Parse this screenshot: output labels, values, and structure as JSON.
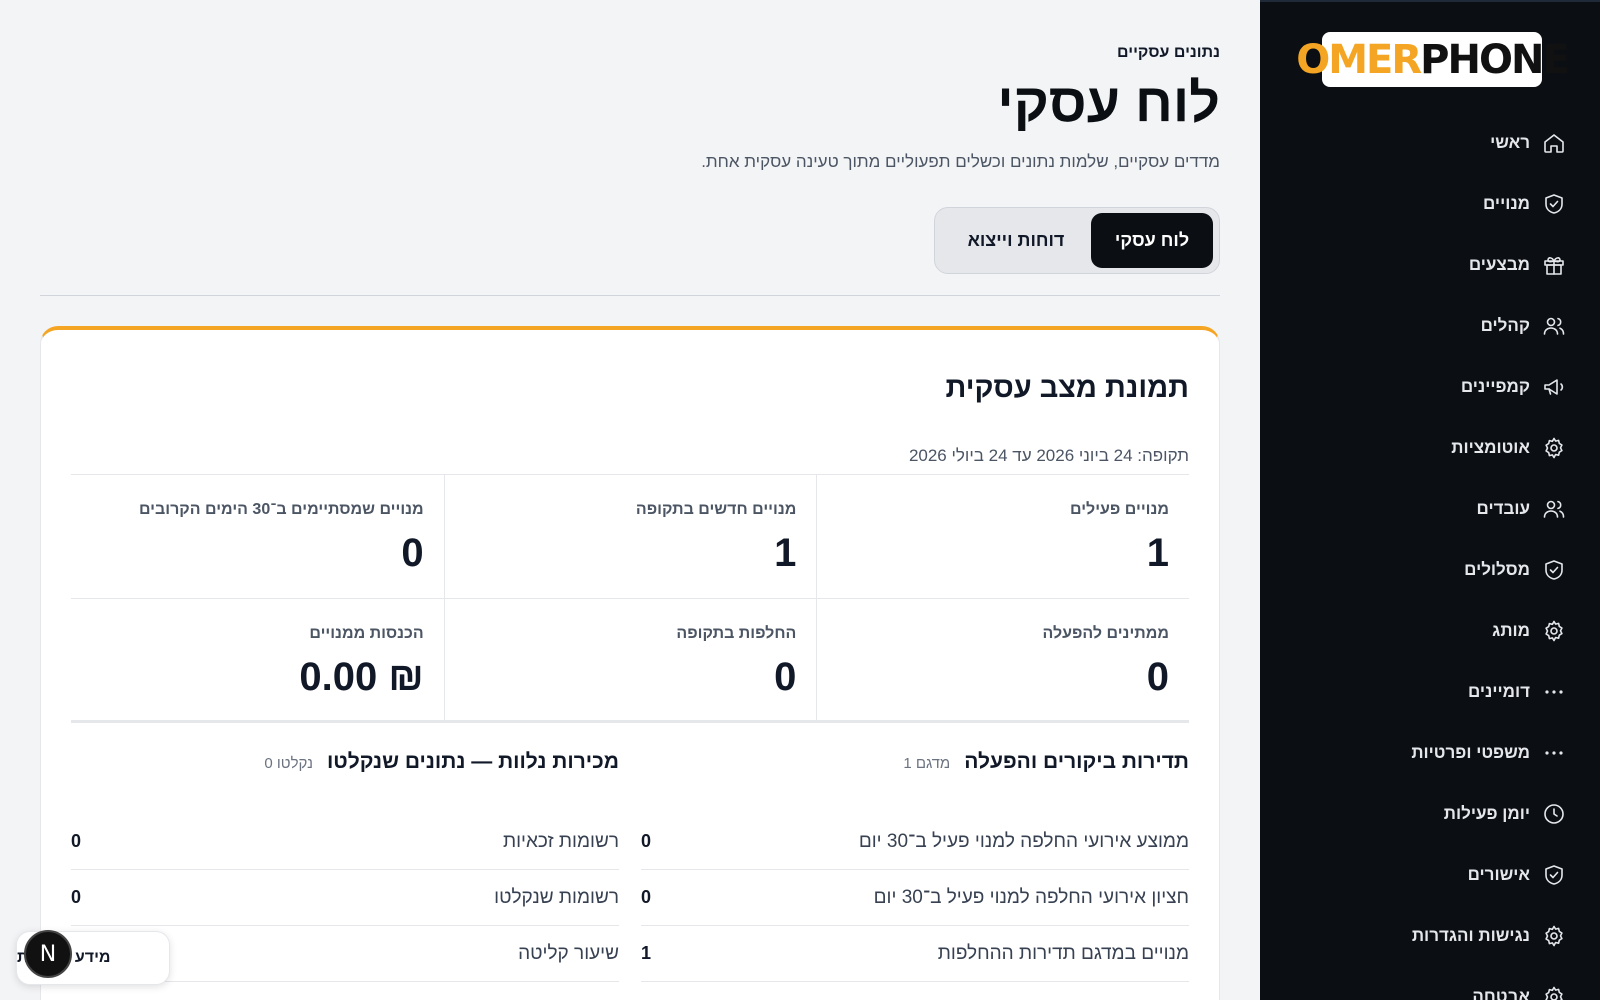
{
  "sidebar": {
    "logo": {
      "part1": "OMER",
      "part2": "PHONE"
    },
    "items": [
      {
        "label": "ראשי",
        "icon": "home-icon"
      },
      {
        "label": "מנויים",
        "icon": "shield-icon"
      },
      {
        "label": "מבצעים",
        "icon": "gift-icon"
      },
      {
        "label": "קהלים",
        "icon": "users-icon"
      },
      {
        "label": "קמפיינים",
        "icon": "megaphone-icon"
      },
      {
        "label": "אוטומציות",
        "icon": "gear-icon"
      },
      {
        "label": "עובדים",
        "icon": "users-icon"
      },
      {
        "label": "מסלולים",
        "icon": "shield-icon"
      },
      {
        "label": "מותג",
        "icon": "gear-icon"
      },
      {
        "label": "דומיינים",
        "icon": "dots-icon"
      },
      {
        "label": "משפטי ופרטיות",
        "icon": "dots-icon"
      },
      {
        "label": "יומן פעילות",
        "icon": "clock-icon"
      },
      {
        "label": "אישורים",
        "icon": "shield-icon"
      },
      {
        "label": "נגישות והגדרות",
        "icon": "gear-icon"
      },
      {
        "label": "אבטחה",
        "icon": "gear-icon"
      }
    ]
  },
  "header": {
    "eyebrow": "נתונים עסקיים",
    "title": "לוח עסקי",
    "subtitle": "מדדים עסקיים, שלמות נתונים וכשלים תפעוליים מתוך טעינה עסקית אחת."
  },
  "tabs": [
    {
      "label": "לוח עסקי",
      "active": true
    },
    {
      "label": "דוחות וייצוא",
      "active": false
    }
  ],
  "card": {
    "title": "תמונת מצב עסקית",
    "period": "תקופה: 24 ביוני 2026 עד 24 ביולי 2026",
    "kpis": [
      {
        "label": "מנויים פעילים",
        "value": "1"
      },
      {
        "label": "מנויים חדשים בתקופה",
        "value": "1"
      },
      {
        "label": "מנויים שמסתיימים ב־30 הימים הקרובים",
        "value": "0"
      },
      {
        "label": "ממתינים להפעלה",
        "value": "0"
      },
      {
        "label": "החלפות בתקופה",
        "value": "0"
      },
      {
        "label": "הכנסות ממנויים",
        "value": "₪ 0.00"
      }
    ],
    "sections": {
      "right": {
        "title": "תדירות ביקורים והפעלה",
        "badge": "מדגם 1",
        "rows": [
          {
            "label": "ממוצע אירועי החלפה למנוי פעיל ב־30 יום",
            "value": "0"
          },
          {
            "label": "חציון אירועי החלפה למנוי פעיל ב־30 יום",
            "value": "0"
          },
          {
            "label": "מנויים במדגם תדירות ההחלפות",
            "value": "1"
          }
        ]
      },
      "left": {
        "title": "מכירות נלוות — נתונים שנקלטו",
        "badge": "נקלטו 0",
        "rows": [
          {
            "label": "רשומות זכאיות",
            "value": "0"
          },
          {
            "label": "רשומות שנקלטו",
            "value": "0"
          },
          {
            "label": "שיעור קליטה",
            "value": ""
          }
        ]
      }
    }
  },
  "floating": {
    "pill_label": "מידע ונגישות",
    "badge_letter": "N"
  },
  "colors": {
    "accent": "#f5a524",
    "sidebar_bg": "#0b0f14",
    "page_bg": "#f3f4f6"
  }
}
